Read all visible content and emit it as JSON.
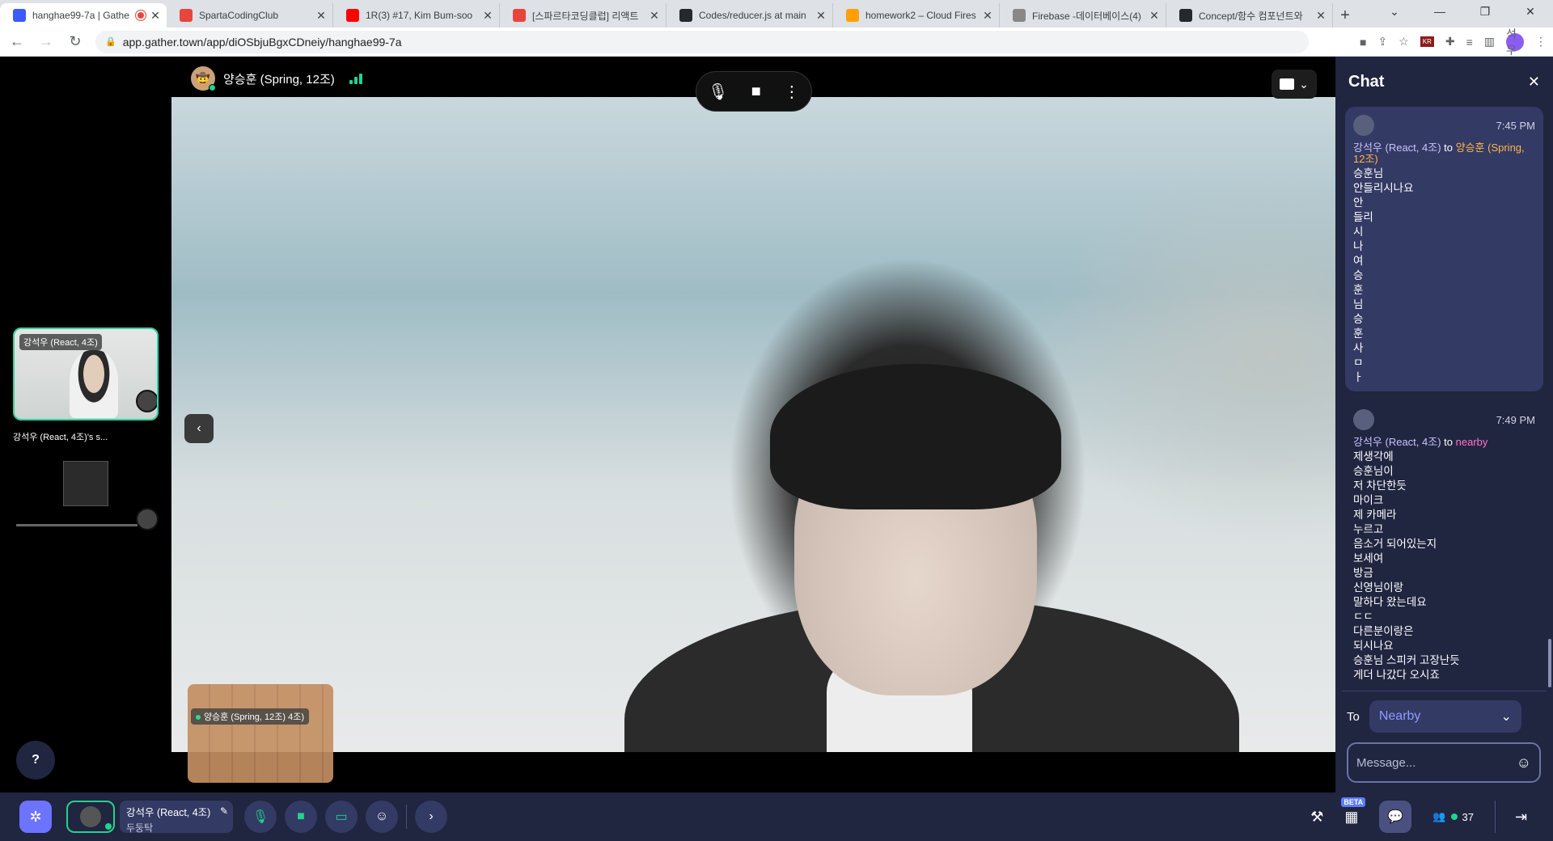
{
  "browser": {
    "tabs": [
      {
        "title": "hanghae99-7a | Gathe",
        "favicon_color": "#3b5bfd",
        "active": true,
        "recording": true
      },
      {
        "title": "SpartaCodingClub",
        "favicon_color": "#e8453c"
      },
      {
        "title": "1R(3) #17, Kim Bum-soo",
        "favicon_color": "#ff0000"
      },
      {
        "title": "[스파르타코딩클럽] 리액트",
        "favicon_color": "#e8453c"
      },
      {
        "title": "Codes/reducer.js at main",
        "favicon_color": "#24292f"
      },
      {
        "title": "homework2 – Cloud Fires",
        "favicon_color": "#ffa000"
      },
      {
        "title": "Firebase -데이터베이스(4)",
        "favicon_color": "#888888"
      },
      {
        "title": "Concept/함수 컴포넌트와",
        "favicon_color": "#24292f"
      }
    ],
    "new_tab": "+",
    "url": "app.gather.town/app/diOSbjuBgxCDneiy/hanghae99-7a",
    "profile_initials": "석우"
  },
  "stage": {
    "participant_name": "양승훈 (Spring, 12조)",
    "side_tile_label": "강석우 (React, 4조)",
    "share_tile_label": "강석우 (React, 4조)'s s...",
    "minimap_label": "양승훈 (Spring, 12조)",
    "minimap_extra": "4조)",
    "help": "?"
  },
  "chat": {
    "title": "Chat",
    "messages": [
      {
        "time": "7:45 PM",
        "from": "강석우 (React, 4조)",
        "to_word": "to",
        "dest": "양승훈 (Spring, 12조)",
        "lines": [
          "승훈님",
          "안들리시나요",
          "안",
          "들리",
          "시",
          "나",
          "여",
          "승",
          "훈",
          "님",
          "승",
          "훈",
          "사",
          "ㅁ",
          "ㅏ"
        ]
      },
      {
        "time": "7:49 PM",
        "from": "강석우 (React, 4조)",
        "to_word": "to",
        "dest": "nearby",
        "lines": [
          "제생각에",
          "승훈님이",
          "저 차단한듯",
          "마이크",
          "제 카메라",
          "누르고",
          "음소거 되어있는지",
          "보세여",
          "방금",
          "신영님이랑",
          "말하다 왔는데요",
          "ㄷㄷ",
          "다른분이랑은",
          "되시나요",
          "승훈님 스피커 고장난듯",
          "게더 나갔다 오시죠"
        ]
      }
    ],
    "to_label": "To",
    "to_value": "Nearby",
    "input_placeholder": "Message..."
  },
  "toolbar": {
    "user_name": "강석우 (React, 4조)",
    "user_status": "두둥탁",
    "beta_label": "BETA",
    "online_count": "37"
  },
  "colors": {
    "accent": "#6c73ff",
    "panel": "#202540",
    "online": "#23d28f",
    "dest_user": "#ffb64b",
    "dest_nearby": "#ff73c8"
  }
}
